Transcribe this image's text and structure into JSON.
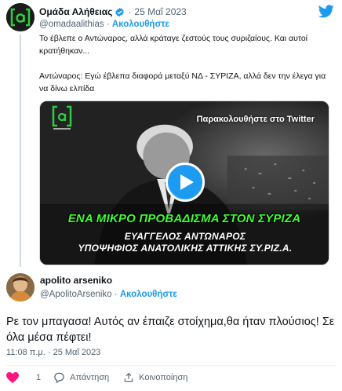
{
  "parent_tweet": {
    "author_name": "Ομάδα Αλήθειας",
    "date": "25 Μαΐ 2023",
    "handle": "@omadaalithias",
    "follow_label": "Ακολουθήστε",
    "text_line1": "Το έβλεπε ο Αντώναρος, αλλά κράταγε ζεστούς τους συριζαίους. Και αυτοί κρατήθηκαν...",
    "text_line2": "Αντώναρος: Εγώ έβλεπα διαφορά μεταξύ ΝΔ - ΣΥΡΙΖΑ, αλλά δεν την έλεγα για να δίνω ελπίδα",
    "video": {
      "watch_label": "Παρακολουθήστε στο Twitter",
      "caption_green": "ΕΝΑ ΜΙΚΡΟ ΠΡΟΒΑΔΙΣΜΑ ΣΤΟΝ ΣΥΡΙΖΑ",
      "lower_third_line1": "ΕΥΑΓΓΕΛΟΣ ΑΝΤΩΝΑΡΟΣ",
      "lower_third_line2": "ΥΠΟΨΗΦΙΟΣ ΑΝΑΤΟΛΙΚΗΣ ΑΤΤΙΚΗΣ ΣΥ.ΡΙΖ.Α."
    }
  },
  "reply_tweet": {
    "author_name": "apolito arseniko",
    "handle": "@ApolitoArseniko",
    "follow_label": "Ακολουθήστε",
    "text": "Ρε τον μπαγασα! Αυτός αν έπαιζε στοίχημα,θα ήταν πλούσιος! Σε όλα μέσα πέφτει!",
    "timestamp": "11:08 π.μ. · 25 Μαΐ 2023"
  },
  "actions": {
    "like_count": "1",
    "reply_label": "Απάντηση",
    "share_label": "Κοινοποίηση"
  },
  "colors": {
    "accent": "#1d9bf0",
    "like": "#f91880",
    "secondary_text": "#536471",
    "green_caption": "#3dff2f"
  }
}
